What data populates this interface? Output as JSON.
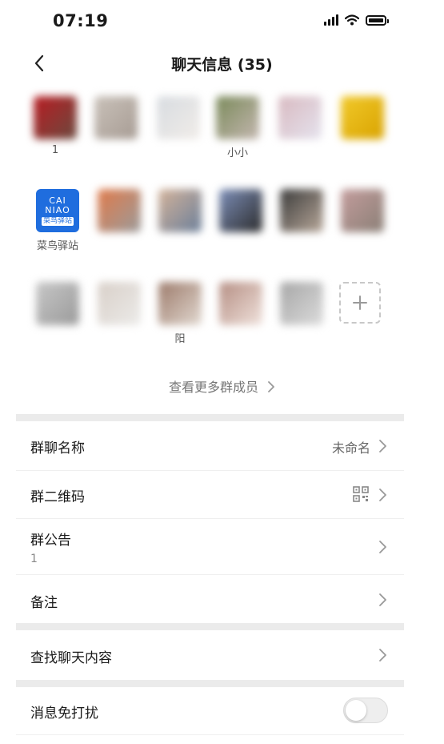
{
  "status_bar": {
    "time": "07:19",
    "icons": [
      "signal-icon",
      "wifi-icon",
      "battery-icon"
    ]
  },
  "nav": {
    "title": "聊天信息 (35)",
    "back_icon": "chevron-left-icon"
  },
  "members": [
    {
      "name": "1",
      "avatar_colors": [
        "#b81c22",
        "#6b4a3f"
      ]
    },
    {
      "name": "",
      "avatar_colors": [
        "#c9c1b9",
        "#a79c94"
      ]
    },
    {
      "name": "",
      "avatar_colors": [
        "#d7dbe0",
        "#f1ede9"
      ]
    },
    {
      "name": "小小",
      "avatar_colors": [
        "#7a8a5a",
        "#c4b7b0"
      ]
    },
    {
      "name": "",
      "avatar_colors": [
        "#d8b9c0",
        "#e5e3ee"
      ]
    },
    {
      "name": "",
      "avatar_colors": [
        "#f1c92a",
        "#d9a300"
      ]
    },
    {
      "name": "菜鸟驿站",
      "avatar_text": [
        "CAI",
        "NIAO",
        "菜鸟驿站"
      ],
      "avatar_colors": [
        "#1f6dde"
      ]
    },
    {
      "name": "",
      "avatar_colors": [
        "#e07a4a",
        "#9b9b9b"
      ]
    },
    {
      "name": "",
      "avatar_colors": [
        "#d4b39a",
        "#6b7f9a"
      ]
    },
    {
      "name": "",
      "avatar_colors": [
        "#7d8fb9",
        "#2b2b2b"
      ]
    },
    {
      "name": "",
      "avatar_colors": [
        "#3a3a3a",
        "#b8a89a"
      ]
    },
    {
      "name": "",
      "avatar_colors": [
        "#c49d9d",
        "#8a7f76"
      ]
    },
    {
      "name": "",
      "avatar_colors": [
        "#c7c7c7",
        "#9a9a9a"
      ]
    },
    {
      "name": "",
      "avatar_colors": [
        "#d8cfc8",
        "#ecebe9"
      ]
    },
    {
      "name": "阳",
      "avatar_colors": [
        "#9c7a6a",
        "#e2d9d1"
      ]
    },
    {
      "name": "",
      "avatar_colors": [
        "#b58e83",
        "#f0e2dc"
      ]
    },
    {
      "name": "",
      "avatar_colors": [
        "#a6a6a6",
        "#dcdcdc"
      ]
    }
  ],
  "add_member_icon": "plus-icon",
  "view_more": "查看更多群成员",
  "settings": {
    "group_name": {
      "label": "群聊名称",
      "value": "未命名"
    },
    "qr_code": {
      "label": "群二维码",
      "icon": "qrcode-icon"
    },
    "announcement": {
      "label": "群公告",
      "sub": "1"
    },
    "remark": {
      "label": "备注"
    },
    "search_history": {
      "label": "查找聊天内容"
    },
    "mute": {
      "label": "消息免打扰",
      "on": false
    }
  }
}
